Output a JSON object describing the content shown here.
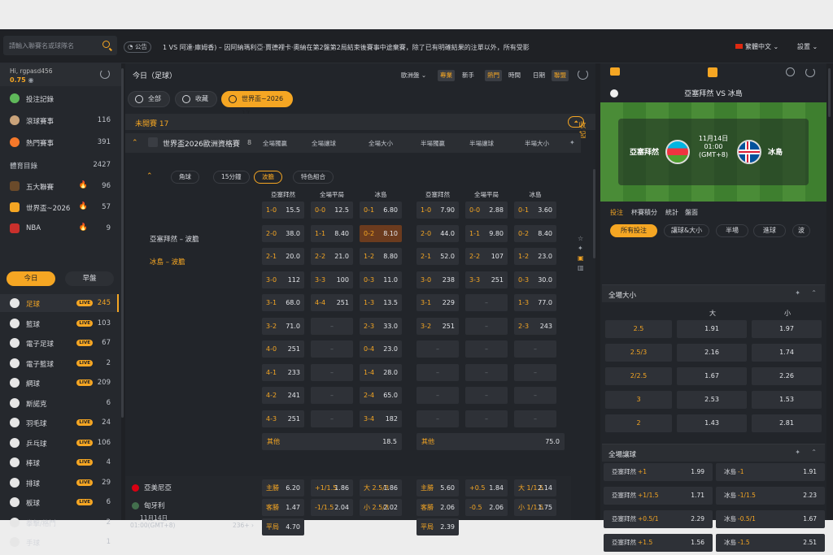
{
  "topbar": {
    "search_placeholder": "請輸入聯賽名或球隊名",
    "notice_tag": "公告",
    "notice": "1 VS 阿達·庫姆香) – 因阿納瑪利亞·賈德裡卡·奧納在第2盤第2局結束後賽事中途棄賽，除了已有明確結果的注單以外，所有受影",
    "language": "繁體中文",
    "settings": "設置"
  },
  "user": {
    "greeting": "Hi, rgpasd456",
    "balance": "0.75"
  },
  "sidebar": {
    "top_items": [
      {
        "label": "投注記錄",
        "count": "",
        "icon": "betslip-icon"
      },
      {
        "label": "滾球賽事",
        "count": "116",
        "icon": "live-icon"
      },
      {
        "label": "熱門賽事",
        "count": "391",
        "icon": "fire-icon"
      }
    ],
    "section_label": "體育目錄",
    "section_count": "2427",
    "featured": [
      {
        "label": "五大聯賽",
        "count": "96"
      },
      {
        "label": "世界盃~2026",
        "count": "57"
      },
      {
        "label": "NBA",
        "count": "9"
      }
    ],
    "toggle": {
      "today": "今日",
      "early": "早盤"
    },
    "sports": [
      {
        "label": "足球",
        "count": "245",
        "active": true
      },
      {
        "label": "籃球",
        "count": "103"
      },
      {
        "label": "電子足球",
        "count": "67"
      },
      {
        "label": "電子籃球",
        "count": "2"
      },
      {
        "label": "網球",
        "count": "209"
      },
      {
        "label": "斯諾克",
        "count": "6"
      },
      {
        "label": "羽毛球",
        "count": "24"
      },
      {
        "label": "乒乓球",
        "count": "106"
      },
      {
        "label": "棒球",
        "count": "4"
      },
      {
        "label": "排球",
        "count": "29"
      },
      {
        "label": "板球",
        "count": "6"
      },
      {
        "label": "拳擊/格鬥",
        "count": "2"
      },
      {
        "label": "手球",
        "count": "1"
      }
    ],
    "live_badge": "LIVE"
  },
  "main": {
    "title": "今日（足球）",
    "controls": [
      "歐洲盤",
      "專業",
      "新手",
      "熱門",
      "時間",
      "日期",
      "聯盟"
    ],
    "tabs": [
      "全部",
      "收藏",
      "世界盃~2026 17"
    ],
    "unstarted": "未開賽 17",
    "collapse": "收起",
    "league": {
      "name": "世界盃2026歐洲資格賽",
      "count": "8",
      "cols": [
        "全場獨贏",
        "全場讓球",
        "全場大小",
        "半場獨贏",
        "半場讓球",
        "半場大小"
      ]
    },
    "cs_tabs": [
      "角球",
      "15分鐘",
      "波膽",
      "特色組合"
    ],
    "cs_heads": [
      "亞塞拜然",
      "全場平局",
      "冰島",
      "亞塞拜然",
      "全場平局",
      "冰島"
    ],
    "teams": [
      "亞塞拜然 – 波膽",
      "冰島 – 波膽"
    ],
    "grid": [
      [
        [
          "1-0",
          "15.5"
        ],
        [
          "0-0",
          "12.5"
        ],
        [
          "0-1",
          "6.80"
        ],
        [
          "1-0",
          "7.90"
        ],
        [
          "0-0",
          "2.88"
        ],
        [
          "0-1",
          "3.60"
        ]
      ],
      [
        [
          "2-0",
          "38.0"
        ],
        [
          "1-1",
          "8.40"
        ],
        [
          "0-2",
          "8.10"
        ],
        [
          "2-0",
          "44.0"
        ],
        [
          "1-1",
          "9.80"
        ],
        [
          "0-2",
          "8.40"
        ]
      ],
      [
        [
          "2-1",
          "20.0"
        ],
        [
          "2-2",
          "21.0"
        ],
        [
          "1-2",
          "8.80"
        ],
        [
          "2-1",
          "52.0"
        ],
        [
          "2-2",
          "107"
        ],
        [
          "1-2",
          "23.0"
        ]
      ],
      [
        [
          "3-0",
          "112"
        ],
        [
          "3-3",
          "100"
        ],
        [
          "0-3",
          "11.0"
        ],
        [
          "3-0",
          "238"
        ],
        [
          "3-3",
          "251"
        ],
        [
          "0-3",
          "30.0"
        ]
      ],
      [
        [
          "3-1",
          "68.0"
        ],
        [
          "4-4",
          "251"
        ],
        [
          "1-3",
          "13.5"
        ],
        [
          "3-1",
          "229"
        ],
        [
          "",
          ""
        ],
        [
          "1-3",
          "77.0"
        ]
      ],
      [
        [
          "3-2",
          "71.0"
        ],
        [
          "",
          ""
        ],
        [
          "2-3",
          "33.0"
        ],
        [
          "3-2",
          "251"
        ],
        [
          "",
          ""
        ],
        [
          "2-3",
          "243"
        ]
      ],
      [
        [
          "4-0",
          "251"
        ],
        [
          "",
          ""
        ],
        [
          "0-4",
          "23.0"
        ],
        [
          "",
          ""
        ],
        [
          "",
          ""
        ],
        [
          "",
          ""
        ]
      ],
      [
        [
          "4-1",
          "233"
        ],
        [
          "",
          ""
        ],
        [
          "1-4",
          "28.0"
        ],
        [
          "",
          ""
        ],
        [
          "",
          ""
        ],
        [
          "",
          ""
        ]
      ],
      [
        [
          "4-2",
          "241"
        ],
        [
          "",
          ""
        ],
        [
          "2-4",
          "65.0"
        ],
        [
          "",
          ""
        ],
        [
          "",
          ""
        ],
        [
          "",
          ""
        ]
      ],
      [
        [
          "4-3",
          "251"
        ],
        [
          "",
          ""
        ],
        [
          "3-4",
          "182"
        ],
        [
          "",
          ""
        ],
        [
          "",
          ""
        ],
        [
          "",
          ""
        ]
      ]
    ],
    "others": [
      [
        "其他",
        "18.5"
      ],
      [
        "其他",
        "75.0"
      ]
    ],
    "dash": "–",
    "match2": {
      "home": "亞美尼亞",
      "away": "匈牙利",
      "date": "11月14日",
      "time": "01:00(GMT+8)",
      "more": "236+",
      "rows": [
        [
          [
            "主勝",
            "6.20"
          ],
          [
            "+1/1.5",
            "1.86"
          ],
          [
            "大 2.5/3",
            "1.86"
          ],
          [
            "主勝",
            "5.60"
          ],
          [
            "+0.5",
            "1.84"
          ],
          [
            "大 1/1.5",
            "2.14"
          ]
        ],
        [
          [
            "客勝",
            "1.47"
          ],
          [
            "-1/1.5",
            "2.04"
          ],
          [
            "小 2.5/3",
            "2.02"
          ],
          [
            "客勝",
            "2.06"
          ],
          [
            "-0.5",
            "2.06"
          ],
          [
            "小 1/1.5",
            "1.75"
          ]
        ],
        [
          [
            "平局",
            "4.70"
          ],
          null,
          null,
          [
            "平局",
            "2.39"
          ],
          null,
          null
        ]
      ]
    }
  },
  "right": {
    "match_title": "亞塞拜然 VS 冰島",
    "home": "亞塞拜然",
    "away": "冰島",
    "date": "11月14日",
    "time": "01:00",
    "tz": "(GMT+8)",
    "tabs": [
      "投注",
      "杯賽積分",
      "統計",
      "盤面"
    ],
    "pills": [
      "所有投注",
      "讓球&大小",
      "半場",
      "進球",
      "波"
    ],
    "ou_title": "全場大小",
    "ou_big": "大",
    "ou_small": "小",
    "ou": [
      [
        "2.5",
        "1.91",
        "1.97"
      ],
      [
        "2.5/3",
        "2.16",
        "1.74"
      ],
      [
        "2/2.5",
        "1.67",
        "2.26"
      ],
      [
        "3",
        "2.53",
        "1.53"
      ],
      [
        "2",
        "1.43",
        "2.81"
      ]
    ],
    "ah_title": "全場讓球",
    "ah": [
      [
        [
          "亞塞拜然",
          "+1",
          "1.99"
        ],
        [
          "冰島",
          "-1",
          "1.91"
        ]
      ],
      [
        [
          "亞塞拜然",
          "+1/1.5",
          "1.71"
        ],
        [
          "冰島",
          "-1/1.5",
          "2.23"
        ]
      ],
      [
        [
          "亞塞拜然",
          "+0.5/1",
          "2.29"
        ],
        [
          "冰島",
          "-0.5/1",
          "1.67"
        ]
      ],
      [
        [
          "亞塞拜然",
          "+1.5",
          "1.56"
        ],
        [
          "冰島",
          "-1.5",
          "2.51"
        ]
      ]
    ]
  },
  "colors": {
    "accent": "#f5a623",
    "bg": "#1f2125",
    "cell": "#2e3137",
    "highlight": "#6b3b1e"
  }
}
